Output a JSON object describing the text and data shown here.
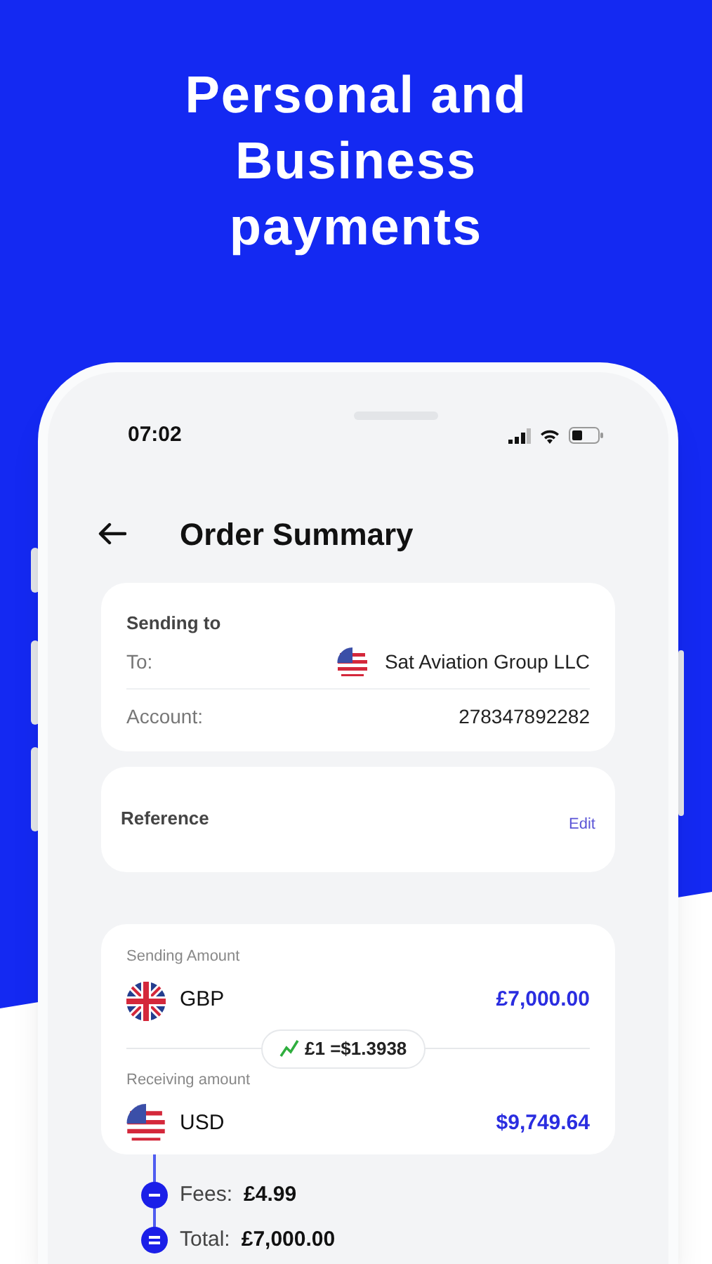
{
  "headline": "Personal and Business payments",
  "status_bar": {
    "time": "07:02"
  },
  "header": {
    "title": "Order Summary"
  },
  "recipient": {
    "heading": "Sending to",
    "rows": [
      {
        "label": "To:",
        "value": "Sat Aviation Group LLC",
        "kind": "us"
      },
      {
        "label": "Account:",
        "value": "278347892282"
      }
    ]
  },
  "reference": {
    "label": "Reference",
    "action": "Edit"
  },
  "amounts": {
    "sending": {
      "label": "Sending Amount",
      "currency": "GBP",
      "kind": "gb",
      "amount": "£7,000.00"
    },
    "rate": "£1 =$1.3938",
    "receiving": {
      "label": "Receiving amount",
      "currency": "USD",
      "kind": "us",
      "amount": "$9,749.64"
    }
  },
  "breakdown": [
    {
      "kind": "minus",
      "label": "Fees:",
      "value": "£4.99"
    },
    {
      "kind": "equals",
      "label": "Total:",
      "value": "£7,000.00"
    }
  ]
}
